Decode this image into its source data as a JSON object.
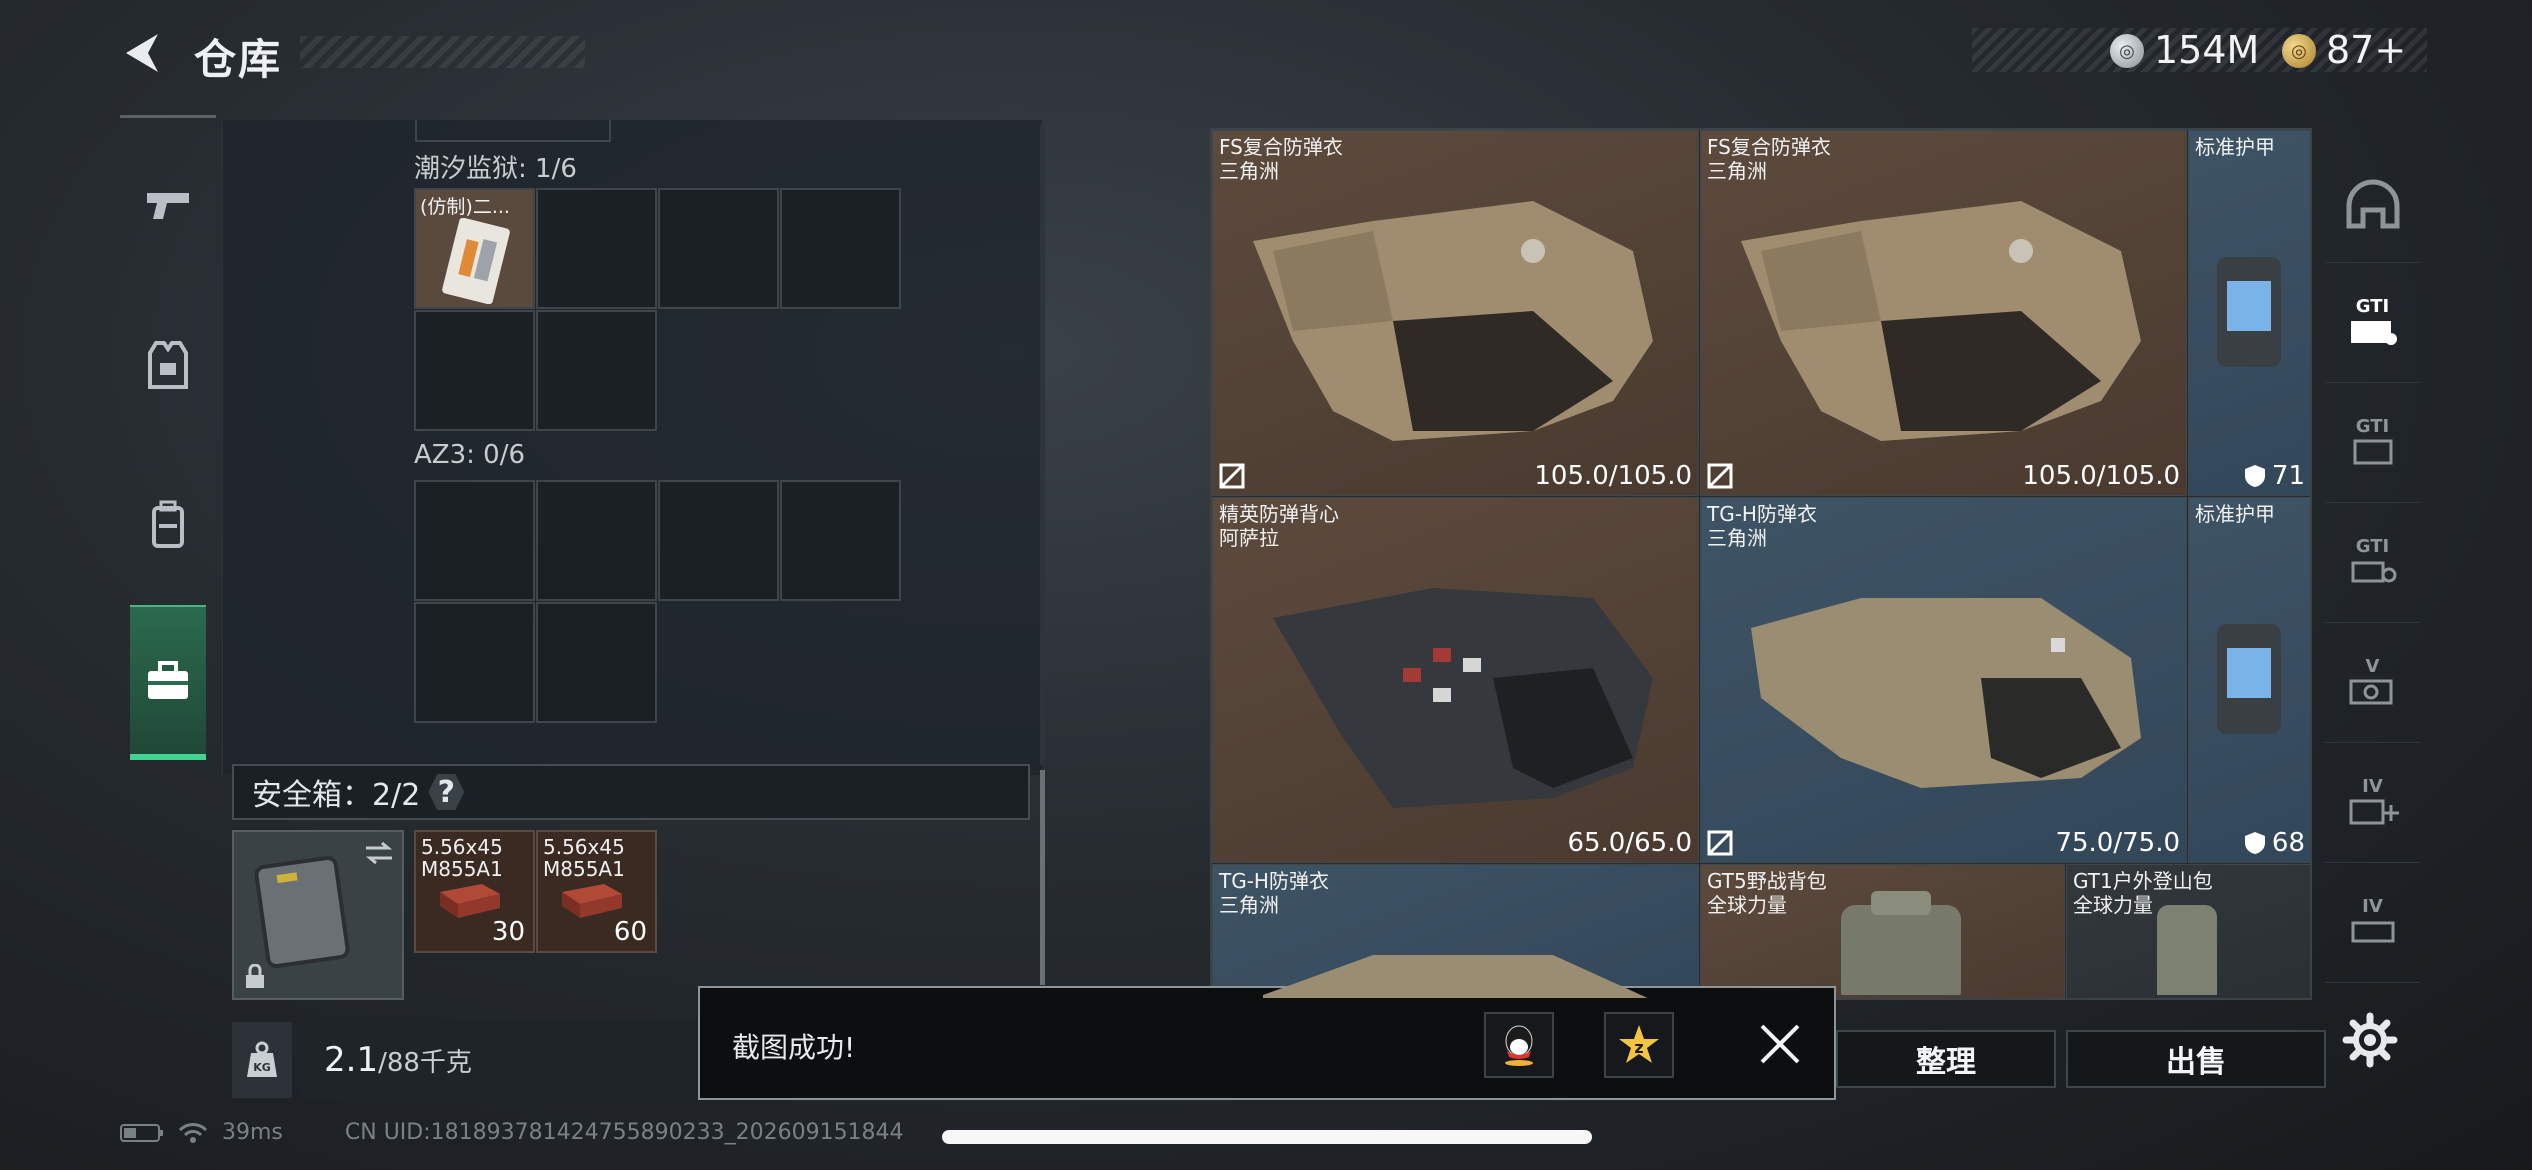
{
  "header": {
    "title": "仓库",
    "currencies": [
      {
        "icon": "silver-coin-icon",
        "amount": "154M"
      },
      {
        "icon": "gold-coin-icon",
        "amount": "87+"
      }
    ]
  },
  "left_nav": {
    "items": [
      {
        "icon": "pistol-icon"
      },
      {
        "icon": "vest-icon"
      },
      {
        "icon": "backpack-icon"
      },
      {
        "icon": "briefcase-icon",
        "active": true
      }
    ]
  },
  "container": {
    "sections": [
      {
        "label": "潮汐监狱: 1/6",
        "items": [
          {
            "name": "(仿制)二..."
          }
        ]
      },
      {
        "label": "AZ3: 0/6"
      }
    ],
    "safe_box": {
      "label": "安全箱：2/2",
      "help": "?",
      "items": [
        {
          "name": "5.56x45 M855A1",
          "count": "30"
        },
        {
          "name": "5.56x45 M855A1",
          "count": "60"
        }
      ]
    },
    "weight": {
      "value": "2.1",
      "unit": "/88千克",
      "icon_label": "KG"
    }
  },
  "status": {
    "ping": "39ms",
    "uid": "CN UID:181893781424755890233_202609151844"
  },
  "items": [
    {
      "name": "FS复合防弹衣",
      "sub": "三角洲",
      "durability": "105.0/105.0"
    },
    {
      "name": "FS复合防弹衣",
      "sub": "三角洲",
      "durability": "105.0/105.0"
    },
    {
      "name": "标准护甲",
      "sub": "",
      "armor": "71"
    },
    {
      "name": "精英防弹背心",
      "sub": "阿萨拉",
      "durability": "65.0/65.0"
    },
    {
      "name": "TG-H防弹衣",
      "sub": "三角洲",
      "durability": "75.0/75.0"
    },
    {
      "name": "标准护甲",
      "sub": "",
      "armor": "68"
    },
    {
      "name": "TG-H防弹衣",
      "sub": "三角洲"
    },
    {
      "name": "GT5野战背包",
      "sub": "全球力量"
    },
    {
      "name": "GT1户外登山包",
      "sub": "全球力量"
    }
  ],
  "filters": [
    {
      "label": "",
      "icon": "helmet-icon"
    },
    {
      "label": "GTI",
      "icon": "armor-filter-icon",
      "active": true
    },
    {
      "label": "GTI",
      "icon": "plate-filter-icon"
    },
    {
      "label": "GTI",
      "icon": "rig-filter-icon"
    },
    {
      "label": "V",
      "icon": "tier-v-filter-icon"
    },
    {
      "label": "IV",
      "icon": "tier-iv-add-icon"
    },
    {
      "label": "IV",
      "icon": "tier-iv-filter-icon"
    }
  ],
  "actions": {
    "sort": "整理",
    "sell": "出售"
  },
  "toast": {
    "message": "截图成功!"
  }
}
